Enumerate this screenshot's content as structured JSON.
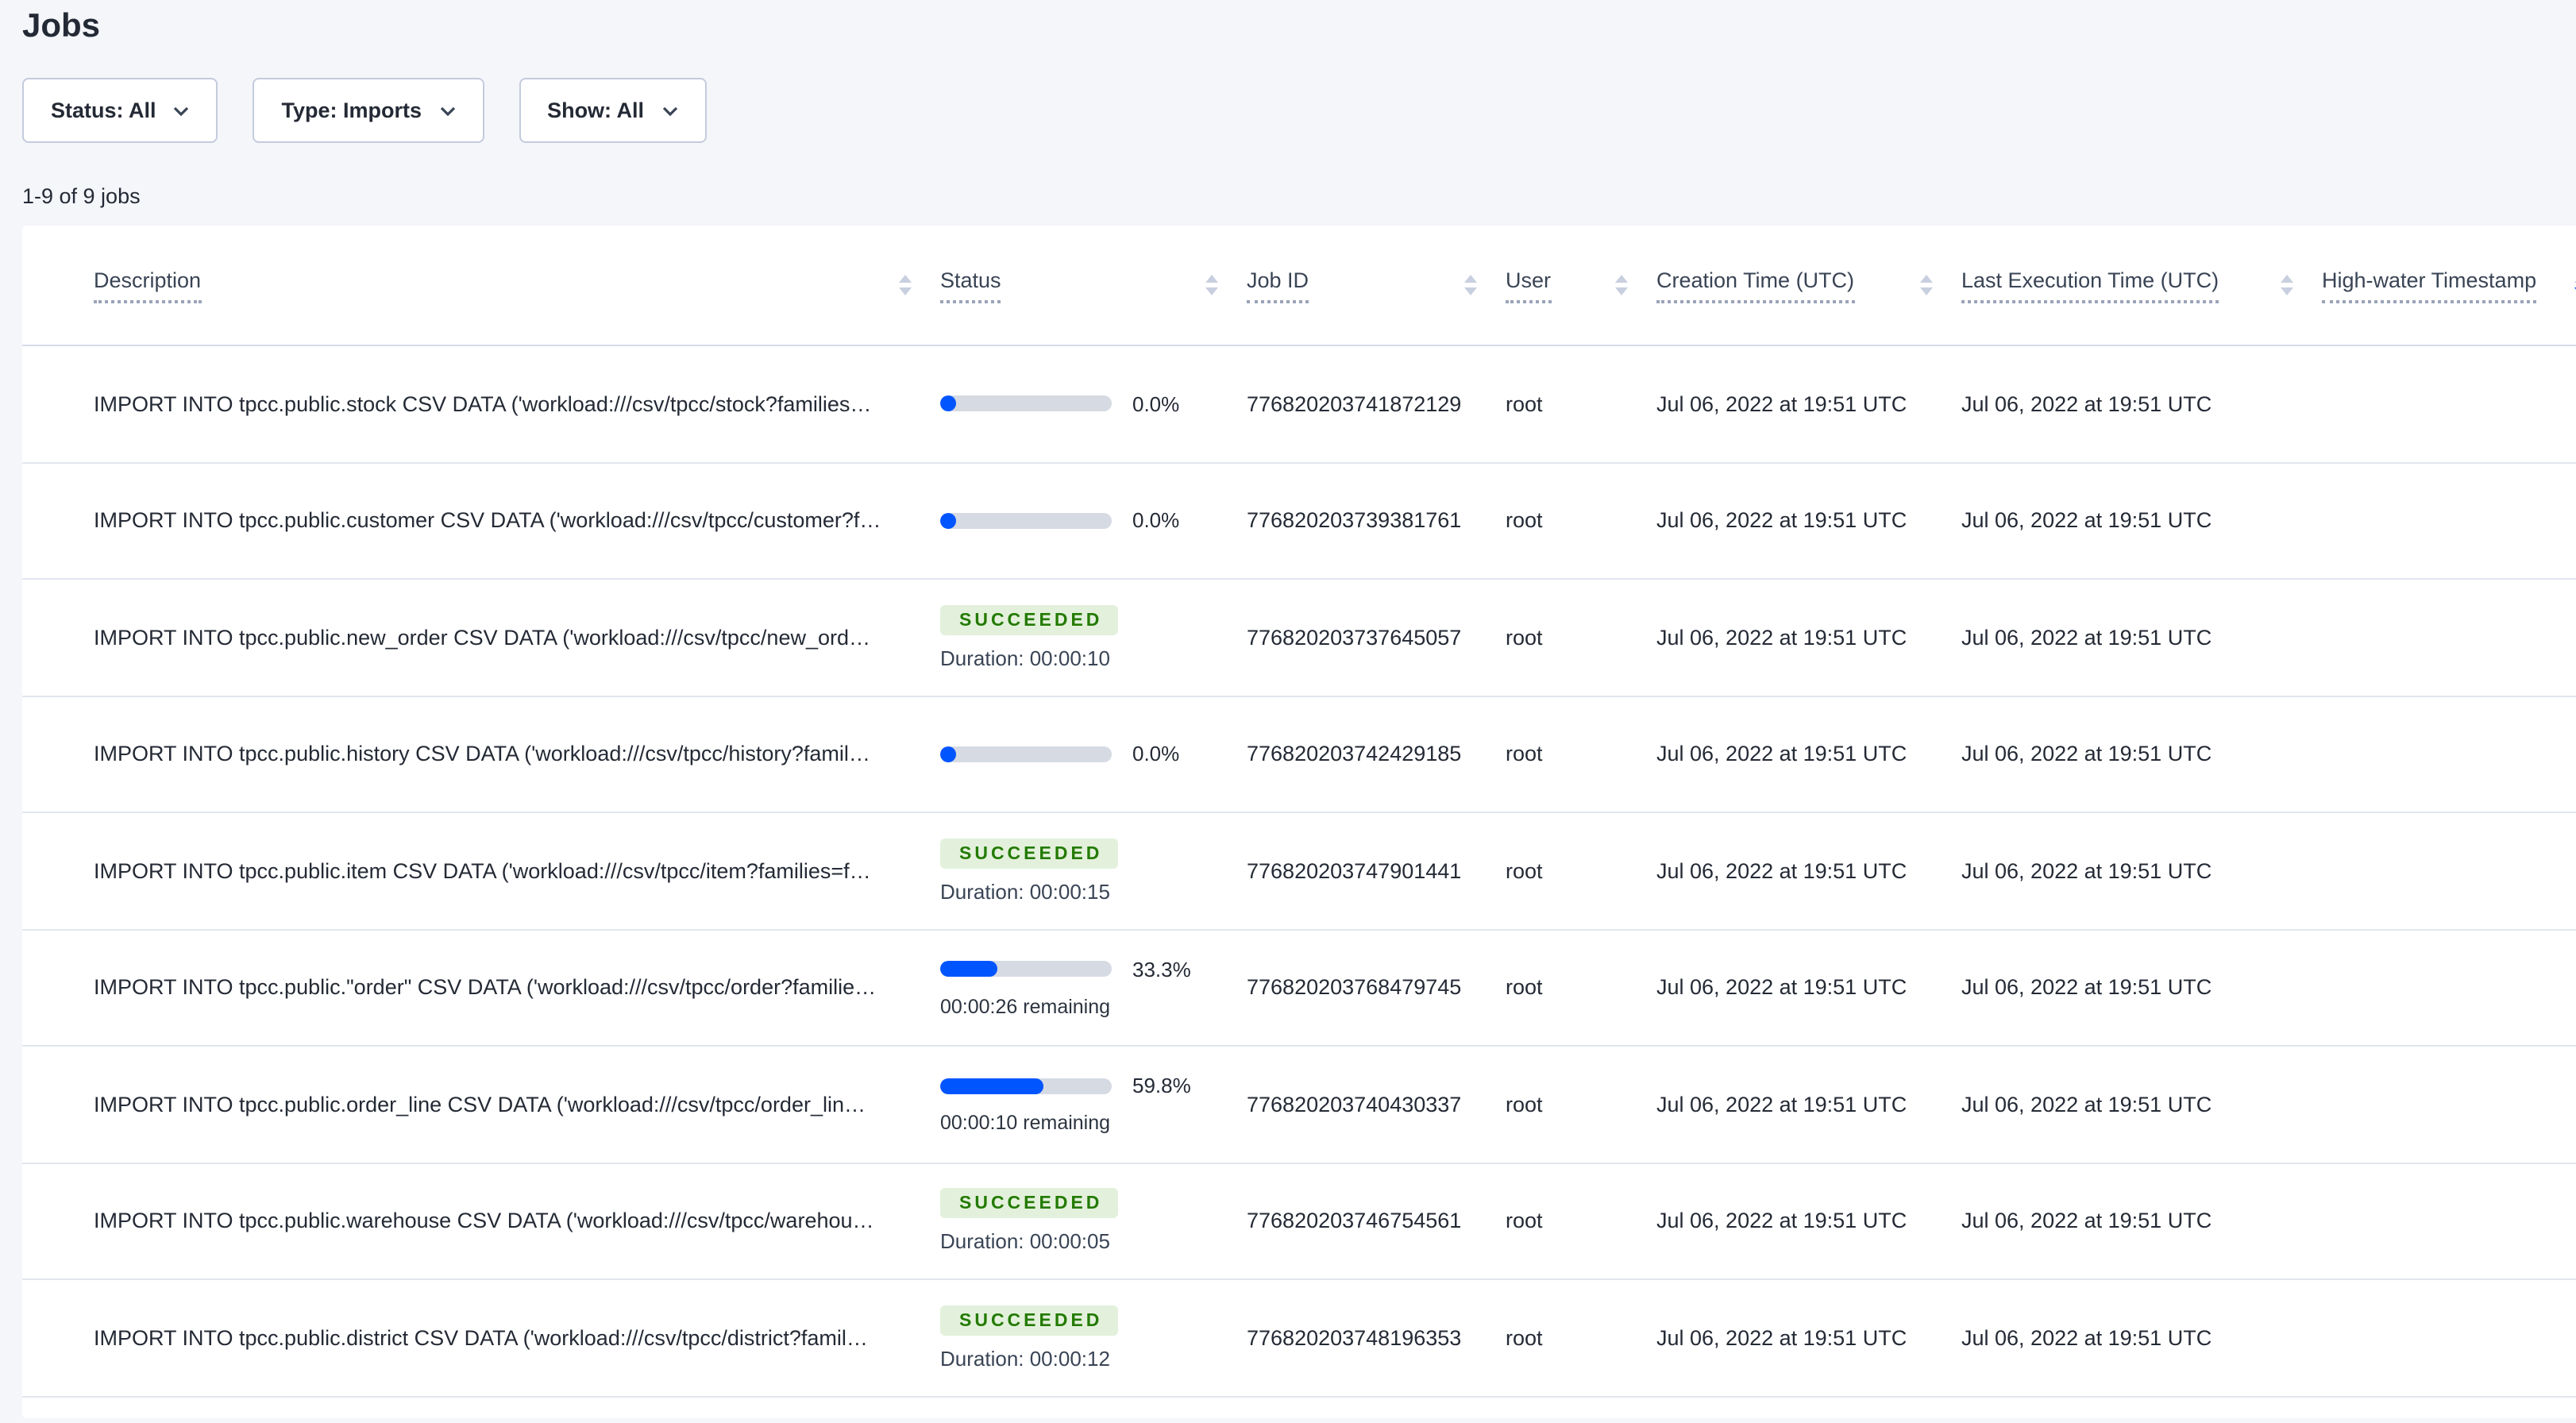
{
  "page": {
    "title": "Jobs",
    "results_count": "1-9 of 9 jobs"
  },
  "filters": {
    "status": "Status: All",
    "type": "Type: Imports",
    "show": "Show: All"
  },
  "colors": {
    "accent_blue": "#0055ff",
    "success_green_text": "#237a00",
    "success_green_bg": "#e3f1dc",
    "page_background": "#f4f6fa",
    "progress_track": "#d5dae3"
  },
  "sort": {
    "column": "High-water Timestamp",
    "direction": "desc"
  },
  "table": {
    "columns": {
      "description": "Description",
      "status": "Status",
      "job_id": "Job ID",
      "user": "User",
      "creation_time": "Creation Time (UTC)",
      "last_execution_time": "Last Execution Time (UTC)",
      "high_water": "High-water Timestamp"
    },
    "rows": [
      {
        "description": "IMPORT INTO tpcc.public.stock CSV DATA ('workload:///csv/tpcc/stock?families…",
        "status": {
          "state": "running",
          "percent_label": "0.0%",
          "percent_value": 0
        },
        "job_id": "776820203741872129",
        "user": "root",
        "creation_time": "Jul 06, 2022 at 19:51 UTC",
        "last_execution_time": "Jul 06, 2022 at 19:51 UTC",
        "high_water": ""
      },
      {
        "description": "IMPORT INTO tpcc.public.customer CSV DATA ('workload:///csv/tpcc/customer?f…",
        "status": {
          "state": "running",
          "percent_label": "0.0%",
          "percent_value": 0
        },
        "job_id": "776820203739381761",
        "user": "root",
        "creation_time": "Jul 06, 2022 at 19:51 UTC",
        "last_execution_time": "Jul 06, 2022 at 19:51 UTC",
        "high_water": ""
      },
      {
        "description": "IMPORT INTO tpcc.public.new_order CSV DATA ('workload:///csv/tpcc/new_ord…",
        "status": {
          "state": "succeeded",
          "badge": "SUCCEEDED",
          "duration": "Duration: 00:00:10"
        },
        "job_id": "776820203737645057",
        "user": "root",
        "creation_time": "Jul 06, 2022 at 19:51 UTC",
        "last_execution_time": "Jul 06, 2022 at 19:51 UTC",
        "high_water": ""
      },
      {
        "description": "IMPORT INTO tpcc.public.history CSV DATA ('workload:///csv/tpcc/history?famil…",
        "status": {
          "state": "running",
          "percent_label": "0.0%",
          "percent_value": 0
        },
        "job_id": "776820203742429185",
        "user": "root",
        "creation_time": "Jul 06, 2022 at 19:51 UTC",
        "last_execution_time": "Jul 06, 2022 at 19:51 UTC",
        "high_water": ""
      },
      {
        "description": "IMPORT INTO tpcc.public.item CSV DATA ('workload:///csv/tpcc/item?families=f…",
        "status": {
          "state": "succeeded",
          "badge": "SUCCEEDED",
          "duration": "Duration: 00:00:15"
        },
        "job_id": "776820203747901441",
        "user": "root",
        "creation_time": "Jul 06, 2022 at 19:51 UTC",
        "last_execution_time": "Jul 06, 2022 at 19:51 UTC",
        "high_water": ""
      },
      {
        "description": "IMPORT INTO tpcc.public.\"order\" CSV DATA ('workload:///csv/tpcc/order?familie…",
        "status": {
          "state": "running",
          "percent_label": "33.3%",
          "percent_value": 33.3,
          "remaining": "00:00:26 remaining"
        },
        "job_id": "776820203768479745",
        "user": "root",
        "creation_time": "Jul 06, 2022 at 19:51 UTC",
        "last_execution_time": "Jul 06, 2022 at 19:51 UTC",
        "high_water": ""
      },
      {
        "description": "IMPORT INTO tpcc.public.order_line CSV DATA ('workload:///csv/tpcc/order_lin…",
        "status": {
          "state": "running",
          "percent_label": "59.8%",
          "percent_value": 59.8,
          "remaining": "00:00:10 remaining"
        },
        "job_id": "776820203740430337",
        "user": "root",
        "creation_time": "Jul 06, 2022 at 19:51 UTC",
        "last_execution_time": "Jul 06, 2022 at 19:51 UTC",
        "high_water": ""
      },
      {
        "description": "IMPORT INTO tpcc.public.warehouse CSV DATA ('workload:///csv/tpcc/warehou…",
        "status": {
          "state": "succeeded",
          "badge": "SUCCEEDED",
          "duration": "Duration: 00:00:05"
        },
        "job_id": "776820203746754561",
        "user": "root",
        "creation_time": "Jul 06, 2022 at 19:51 UTC",
        "last_execution_time": "Jul 06, 2022 at 19:51 UTC",
        "high_water": ""
      },
      {
        "description": "IMPORT INTO tpcc.public.district CSV DATA ('workload:///csv/tpcc/district?famil…",
        "status": {
          "state": "succeeded",
          "badge": "SUCCEEDED",
          "duration": "Duration: 00:00:12"
        },
        "job_id": "776820203748196353",
        "user": "root",
        "creation_time": "Jul 06, 2022 at 19:51 UTC",
        "last_execution_time": "Jul 06, 2022 at 19:51 UTC",
        "high_water": ""
      }
    ]
  }
}
